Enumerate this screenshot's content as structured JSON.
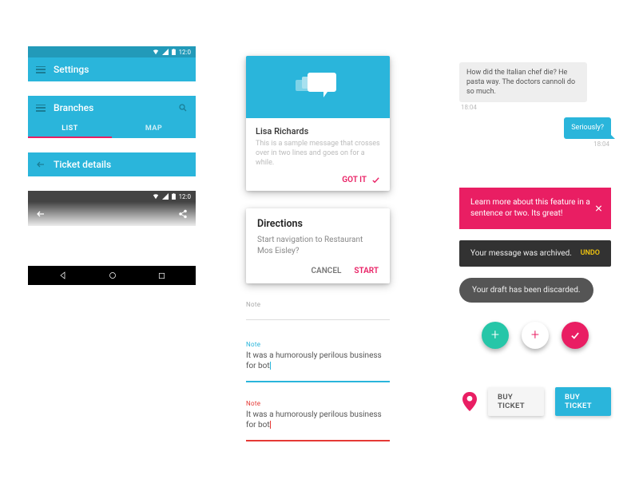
{
  "statusbar": {
    "time": "12:0"
  },
  "appbars": {
    "settings_title": "Settings",
    "branches_title": "Branches",
    "branches_tabs": {
      "list": "LIST",
      "map": "MAP"
    },
    "details_title": "Ticket details"
  },
  "notice_card": {
    "name": "Lisa Richards",
    "message": "This is a sample message that crosses over in two lines and goes on for a while.",
    "action_label": "GOT IT"
  },
  "dialog": {
    "title": "Directions",
    "body": "Start navigation to Restaurant Mos Eisley?",
    "cancel": "CANCEL",
    "confirm": "START"
  },
  "fields": {
    "empty_label": "Note",
    "active_label": "Note",
    "active_value": "It was a humorously perilous business for bot",
    "error_label": "Note",
    "error_value": "It was a humorously perilous business for bot"
  },
  "chat": {
    "incoming_text": "How did the Italian chef die? He pasta way. The doctors cannoli do so much.",
    "incoming_time": "18:04",
    "outgoing_text": "Seriously?",
    "outgoing_time": "18:04"
  },
  "promo": {
    "text": "Learn more about this feature in a sentence or two. Its great!"
  },
  "snackbars": {
    "archived_text": "Your message was archived.",
    "archived_action": "UNDO",
    "discarded_text": "Your draft has been discarded."
  },
  "buttons": {
    "buy_light": "BUY TICKET",
    "buy_blue": "BUY TICKET"
  },
  "colors": {
    "primary": "#2ab5db",
    "accent": "#e91e63",
    "teal": "#26c6a8",
    "error": "#e53935"
  }
}
